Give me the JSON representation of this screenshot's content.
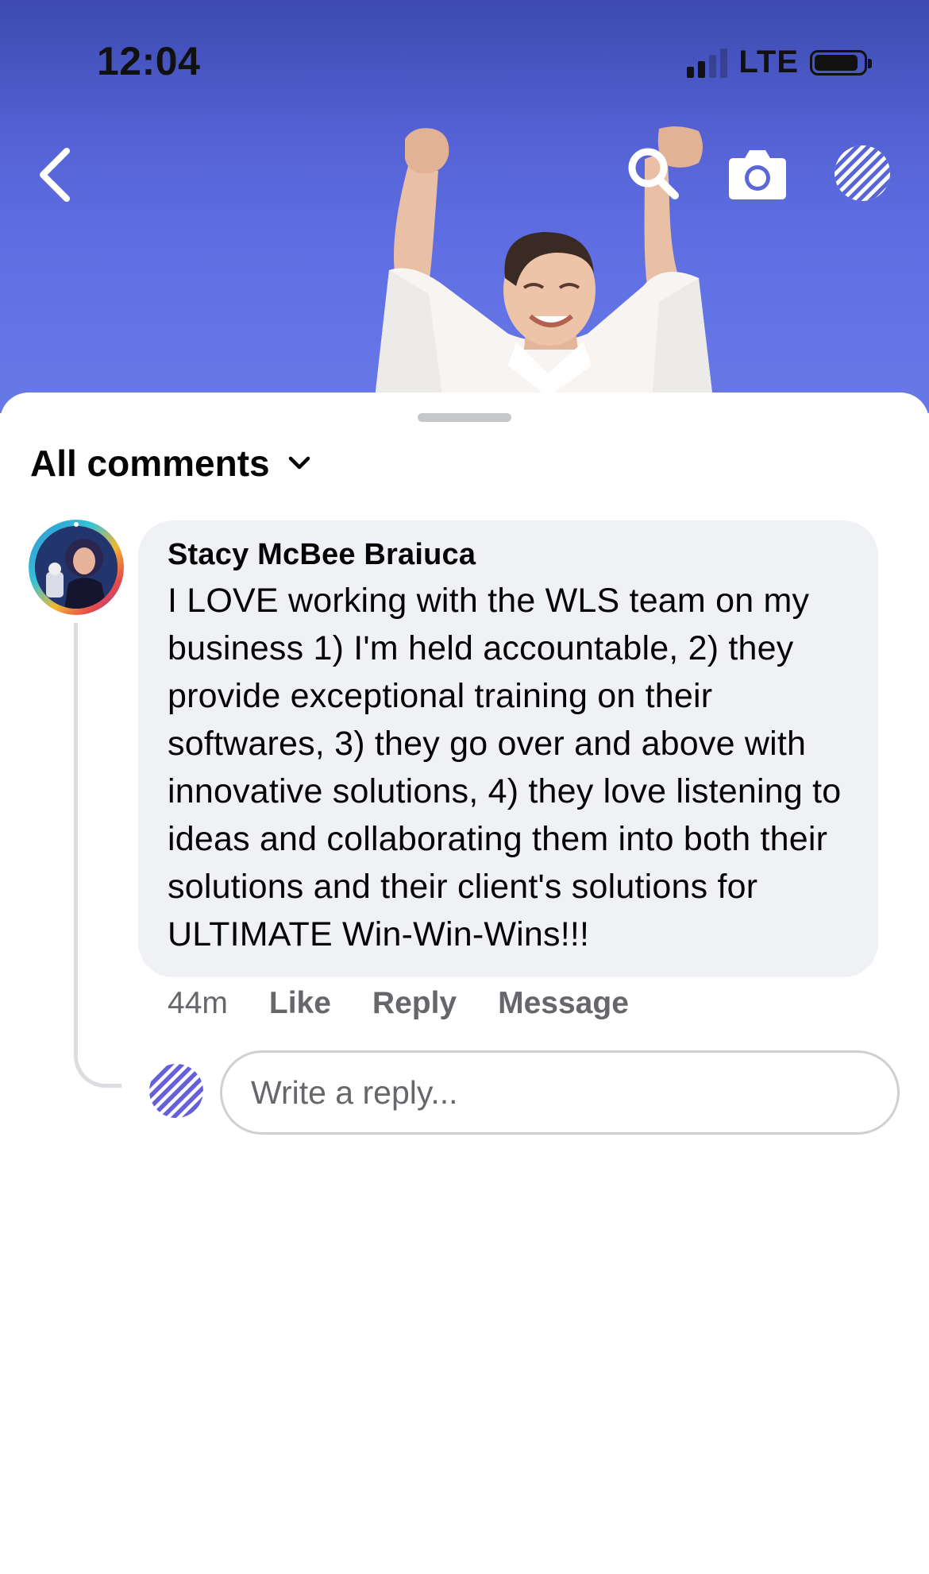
{
  "status_bar": {
    "time": "12:04",
    "network": "LTE",
    "signal_bars": 2,
    "battery_level": 0.9
  },
  "top_nav": {
    "back_icon": "chevron-left-icon",
    "search_icon": "search-icon",
    "camera_icon": "camera-icon",
    "profile_icon": "striped-avatar-icon"
  },
  "comments": {
    "filter_label": "All comments",
    "filter_icon": "chevron-down-icon",
    "items": [
      {
        "author": "Stacy McBee Braiuca",
        "text": "I LOVE working with the WLS team on my business 1) I'm held accountable, 2) they provide exceptional training on their softwares, 3) they go over and above with innovative solutions, 4) they love listening to ideas and collaborating them into both their solutions and their client's solutions for ULTIMATE Win-Win-Wins!!!",
        "time": "44m",
        "like_label": "Like",
        "reply_label": "Reply",
        "message_label": "Message"
      }
    ]
  },
  "reply_box": {
    "placeholder": "Write a reply..."
  },
  "colors": {
    "accent": "#5b6be0",
    "bubble": "#f0f1f4",
    "secondary_text": "#65676b"
  }
}
